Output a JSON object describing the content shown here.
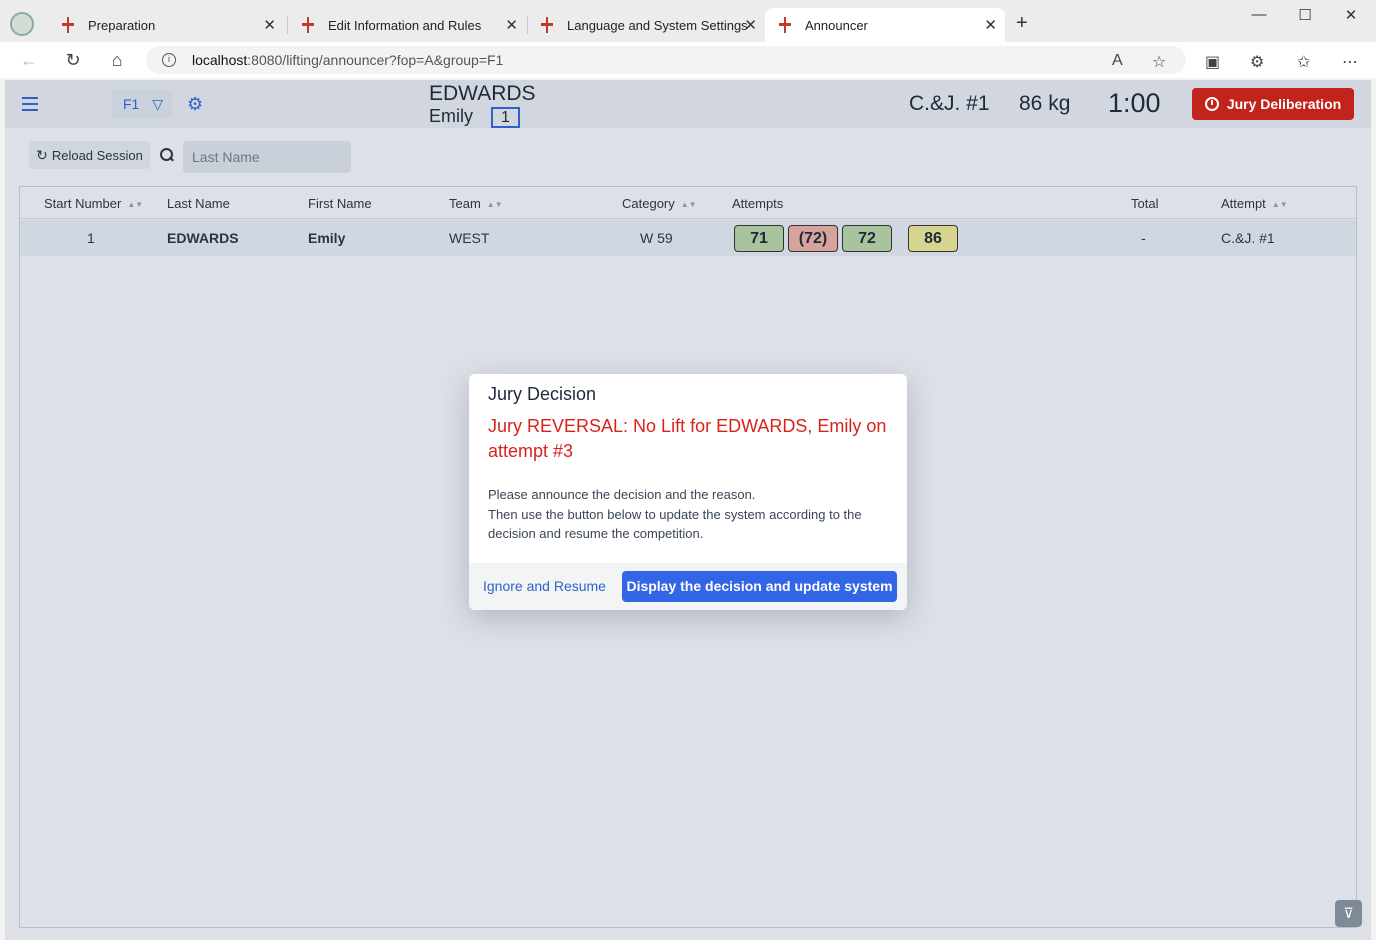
{
  "browser": {
    "tabs": [
      {
        "label": "Preparation"
      },
      {
        "label": "Edit Information and Rules"
      },
      {
        "label": "Language and System Settings"
      },
      {
        "label": "Announcer"
      }
    ],
    "url_host": "localhost",
    "url_path": ":8080/lifting/announcer?fop=A&group=F1"
  },
  "header": {
    "group": "F1",
    "athlete_last": "EDWARDS",
    "athlete_first": "Emily",
    "start_number": "1",
    "attempt": "C.&J. #1",
    "weight": "86 kg",
    "timer": "1:00",
    "jury_button": "Jury Deliberation"
  },
  "toolbar": {
    "reload_label": "Reload Session",
    "search_placeholder": "Last Name"
  },
  "grid": {
    "columns": {
      "start_number": "Start Number",
      "last_name": "Last Name",
      "first_name": "First Name",
      "team": "Team",
      "category": "Category",
      "attempts": "Attempts",
      "total": "Total",
      "attempt": "Attempt"
    },
    "rows": [
      {
        "start_number": "1",
        "last_name": "EDWARDS",
        "first_name": "Emily",
        "team": "WEST",
        "category": "W 59",
        "attempts": [
          {
            "value": "71",
            "status": "good"
          },
          {
            "value": "(72)",
            "status": "bad"
          },
          {
            "value": "72",
            "status": "good"
          },
          {
            "value": "86",
            "status": "requested"
          }
        ],
        "total": "-",
        "attempt": "C.&J. #1"
      }
    ]
  },
  "dialog": {
    "title": "Jury Decision",
    "message": "Jury REVERSAL: No Lift for EDWARDS, Emily on attempt #3",
    "body_line1": "Please announce the decision and the reason.",
    "body_line2": "Then use the button below to update the system according to the decision and resume the competition.",
    "ignore_button": "Ignore and Resume",
    "display_button": "Display the decision and update system"
  },
  "colors": {
    "accent": "#2f62c9",
    "jury_red": "#c2231b",
    "message_red": "#d9231a",
    "good_lift": "#a9c39e",
    "bad_lift": "#d7a39d",
    "requested": "#d6d48e"
  }
}
